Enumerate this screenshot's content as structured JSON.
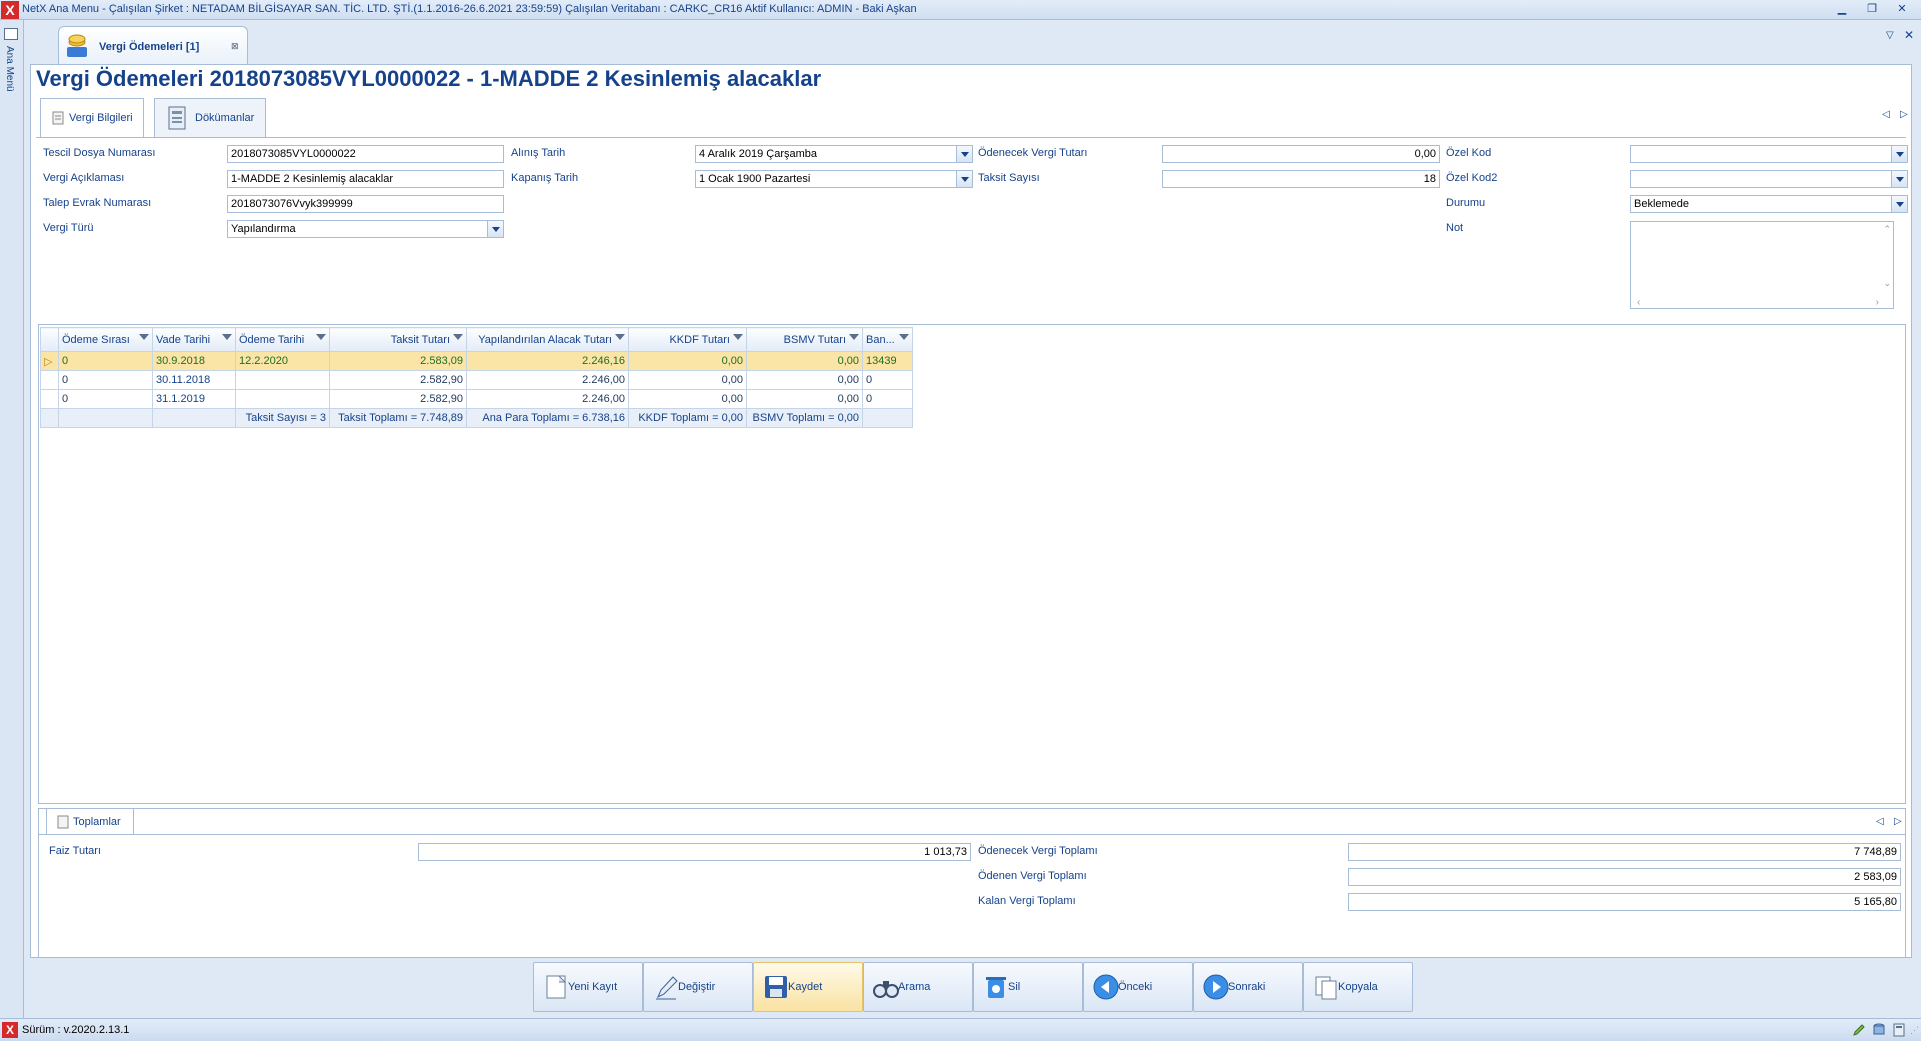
{
  "window": {
    "title": "NetX Ana Menu - Çalışılan Şirket : NETADAM BİLGİSAYAR SAN. TİC. LTD. ŞTİ.(1.1.2016-26.6.2021 23:59:59) Çalışılan Veritabanı : CARKC_CR16  Aktif Kullanıcı: ADMIN - Baki Aşkan",
    "app_icon": "X",
    "minimize": "▁",
    "restore": "❐",
    "close": "✕"
  },
  "sidebar": {
    "label": "Ana Menü"
  },
  "doc_tab": {
    "label": "Vergi Ödemeleri [1]",
    "close": "⊠",
    "arrow": "▽",
    "close_all": "✕"
  },
  "page": {
    "title": "Vergi Ödemeleri 2018073085VYL0000022 - 1-MADDE 2 Kesinlemiş alacaklar"
  },
  "inner_tabs": [
    {
      "label": "Vergi Bilgileri"
    },
    {
      "label": "Dökümanlar"
    }
  ],
  "nav": {
    "prev": "◁",
    "next": "▷"
  },
  "form": {
    "tescil_dosya_numarasi": {
      "label": "Tescil Dosya Numarası",
      "value": "2018073085VYL0000022"
    },
    "vergi_aciklamasi": {
      "label": "Vergi Açıklaması",
      "value": "1-MADDE 2 Kesinlemiş alacaklar"
    },
    "talep_evrak_numarasi": {
      "label": "Talep Evrak Numarası",
      "value": "2018073076Vvyk399999"
    },
    "vergi_turu": {
      "label": "Vergi Türü",
      "value": "Yapılandırma"
    },
    "alinis_tarih": {
      "label": "Alınış Tarih",
      "value": "4 Aralık 2019 Çarşamba"
    },
    "kapanis_tarih": {
      "label": "Kapanış Tarih",
      "value": "1 Ocak 1900 Pazartesi"
    },
    "odenecek_vergi_tutari": {
      "label": "Ödenecek Vergi Tutarı",
      "value": "0,00"
    },
    "taksit_sayisi": {
      "label": "Taksit Sayısı",
      "value": "18"
    },
    "ozel_kod": {
      "label": "Özel Kod",
      "value": ""
    },
    "ozel_kod2": {
      "label": "Özel Kod2",
      "value": ""
    },
    "durumu": {
      "label": "Durumu",
      "value": "Beklemede"
    },
    "not": {
      "label": "Not",
      "value": ""
    }
  },
  "grid": {
    "columns": [
      "Ödeme Sırası",
      "Vade Tarihi",
      "Ödeme Tarihi",
      "Taksit Tutarı",
      "Yapılandırılan Alacak Tutarı",
      "KKDF Tutarı",
      "BSMV Tutarı",
      "Ban..."
    ],
    "rows": [
      [
        "0",
        "30.9.2018",
        "12.2.2020",
        "2.583,09",
        "2.246,16",
        "0,00",
        "0,00",
        "13439"
      ],
      [
        "0",
        "30.11.2018",
        "",
        "2.582,90",
        "2.246,00",
        "0,00",
        "0,00",
        "0"
      ],
      [
        "0",
        "31.1.2019",
        "",
        "2.582,90",
        "2.246,00",
        "0,00",
        "0,00",
        "0"
      ]
    ],
    "footer": [
      "",
      "",
      "Taksit Sayısı = 3",
      "Taksit Toplamı = 7.748,89",
      "Ana Para Toplamı = 6.738,16",
      "KKDF Toplamı = 0,00",
      "BSMV Toplamı = 0,00",
      ""
    ],
    "row_indicator": "▷"
  },
  "totals": {
    "tab_label": "Toplamlar",
    "faiz_tutari": {
      "label": "Faiz Tutarı",
      "value": "1 013,73"
    },
    "odenecek_vergi_toplami": {
      "label": "Ödenecek Vergi Toplamı",
      "value": "7 748,89"
    },
    "odenen_vergi_toplami": {
      "label": "Ödenen Vergi Toplamı",
      "value": "2 583,09"
    },
    "kalan_vergi_toplami": {
      "label": "Kalan Vergi Toplamı",
      "value": "5 165,80"
    }
  },
  "buttons": [
    {
      "label": "Yeni Kayıt",
      "icon": "new-record-icon"
    },
    {
      "label": "Değiştir",
      "icon": "edit-icon"
    },
    {
      "label": "Kaydet",
      "icon": "save-icon"
    },
    {
      "label": "Arama",
      "icon": "binoculars-icon"
    },
    {
      "label": "Sil",
      "icon": "trash-icon"
    },
    {
      "label": "Önceki",
      "icon": "previous-icon"
    },
    {
      "label": "Sonraki",
      "icon": "next-icon"
    },
    {
      "label": "Kopyala",
      "icon": "copy-icon"
    }
  ],
  "status": {
    "version": "Sürüm : v.2020.2.13.1"
  },
  "colors": {
    "accent": "#15428b",
    "border": "#a7bcd6",
    "selected_row": "#fbe5a6",
    "app_red": "#d42a2a"
  }
}
